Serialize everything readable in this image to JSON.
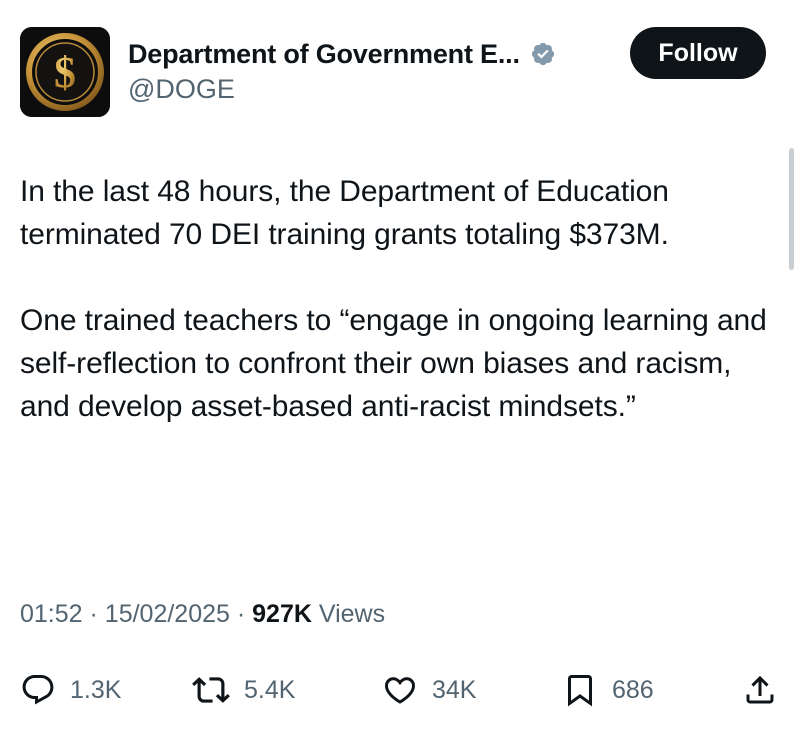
{
  "account": {
    "name": "Department of Government E...",
    "handle": "@DOGE",
    "verified_icon": "verified-badge-icon",
    "avatar_icon": "dollar-coin-icon",
    "avatar_symbol": "$"
  },
  "follow_button": {
    "label": "Follow"
  },
  "tweet": {
    "paragraphs": [
      "In the last 48 hours, the Department of Education terminated 70 DEI training grants totaling $373M.",
      "One trained teachers to “engage in ongoing learning and self-reflection to confront their own biases and racism, and develop asset-based anti-racist mindsets.”"
    ]
  },
  "meta": {
    "time": "01:52",
    "separator": "·",
    "date": "15/02/2025",
    "views_count": "927K",
    "views_label": "Views"
  },
  "actions": {
    "replies": {
      "icon": "reply-icon",
      "count": "1.3K"
    },
    "reposts": {
      "icon": "repost-icon",
      "count": "5.4K"
    },
    "likes": {
      "icon": "heart-icon",
      "count": "34K"
    },
    "bookmarks": {
      "icon": "bookmark-icon",
      "count": "686"
    },
    "share": {
      "icon": "share-icon"
    }
  },
  "colors": {
    "text": "#0f1419",
    "secondary": "#536471",
    "verified": "#829aab",
    "avatar_gold": "#d4a64a",
    "avatar_bg": "#0d0d0d"
  }
}
